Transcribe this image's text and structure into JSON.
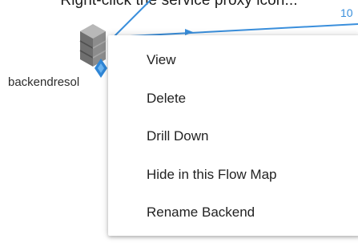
{
  "instruction_text": "Right-click the service proxy icon...",
  "flow_map": {
    "edge_label": "10",
    "node_label": "backendresol",
    "edge_color": "#3a8fdc"
  },
  "context_menu": {
    "items": [
      {
        "label": "View"
      },
      {
        "label": "Delete"
      },
      {
        "label": "Drill Down"
      },
      {
        "label": "Hide in this Flow Map"
      },
      {
        "label": "Rename Backend"
      }
    ]
  }
}
